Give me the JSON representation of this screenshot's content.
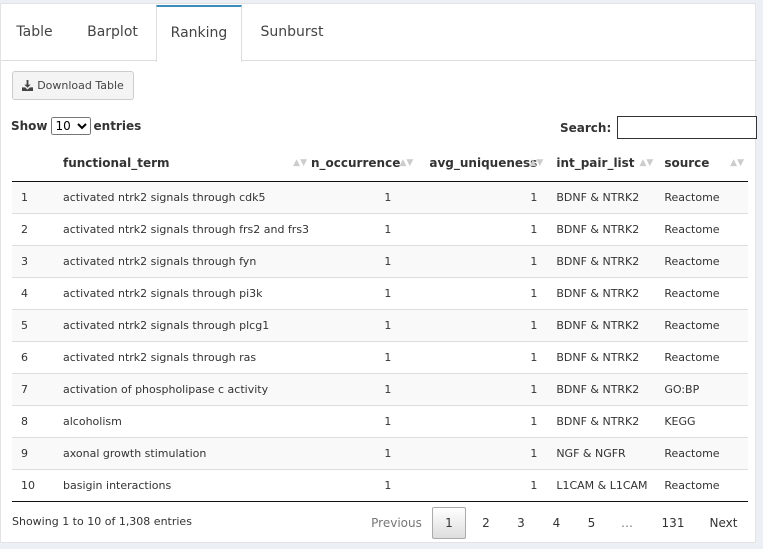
{
  "tabs": [
    "Table",
    "Barplot",
    "Ranking",
    "Sunburst"
  ],
  "active_tab": 2,
  "download_label": "Download Table",
  "show_prefix": "Show",
  "show_value": "10",
  "show_suffix": "entries",
  "search_label": "Search:",
  "columns": [
    "functional_term",
    "n_occurrence",
    "avg_uniqueness",
    "int_pair_list",
    "source"
  ],
  "rows": [
    {
      "idx": "1",
      "functional_term": "activated ntrk2 signals through cdk5",
      "n_occurrence": "1",
      "avg_uniqueness": "1",
      "int_pair_list": "BDNF & NTRK2",
      "source": "Reactome"
    },
    {
      "idx": "2",
      "functional_term": "activated ntrk2 signals through frs2 and frs3",
      "n_occurrence": "1",
      "avg_uniqueness": "1",
      "int_pair_list": "BDNF & NTRK2",
      "source": "Reactome"
    },
    {
      "idx": "3",
      "functional_term": "activated ntrk2 signals through fyn",
      "n_occurrence": "1",
      "avg_uniqueness": "1",
      "int_pair_list": "BDNF & NTRK2",
      "source": "Reactome"
    },
    {
      "idx": "4",
      "functional_term": "activated ntrk2 signals through pi3k",
      "n_occurrence": "1",
      "avg_uniqueness": "1",
      "int_pair_list": "BDNF & NTRK2",
      "source": "Reactome"
    },
    {
      "idx": "5",
      "functional_term": "activated ntrk2 signals through plcg1",
      "n_occurrence": "1",
      "avg_uniqueness": "1",
      "int_pair_list": "BDNF & NTRK2",
      "source": "Reactome"
    },
    {
      "idx": "6",
      "functional_term": "activated ntrk2 signals through ras",
      "n_occurrence": "1",
      "avg_uniqueness": "1",
      "int_pair_list": "BDNF & NTRK2",
      "source": "Reactome"
    },
    {
      "idx": "7",
      "functional_term": "activation of phospholipase c activity",
      "n_occurrence": "1",
      "avg_uniqueness": "1",
      "int_pair_list": "BDNF & NTRK2",
      "source": "GO:BP"
    },
    {
      "idx": "8",
      "functional_term": "alcoholism",
      "n_occurrence": "1",
      "avg_uniqueness": "1",
      "int_pair_list": "BDNF & NTRK2",
      "source": "KEGG"
    },
    {
      "idx": "9",
      "functional_term": "axonal growth stimulation",
      "n_occurrence": "1",
      "avg_uniqueness": "1",
      "int_pair_list": "NGF & NGFR",
      "source": "Reactome"
    },
    {
      "idx": "10",
      "functional_term": "basigin interactions",
      "n_occurrence": "1",
      "avg_uniqueness": "1",
      "int_pair_list": "L1CAM & L1CAM",
      "source": "Reactome"
    }
  ],
  "info": "Showing 1 to 10 of 1,308 entries",
  "pager": {
    "previous": "Previous",
    "pages": [
      "1",
      "2",
      "3",
      "4",
      "5",
      "…",
      "131"
    ],
    "current": "1",
    "next": "Next"
  },
  "colors": {
    "accent": "#3c8dbc",
    "background": "#ecf0f5"
  }
}
